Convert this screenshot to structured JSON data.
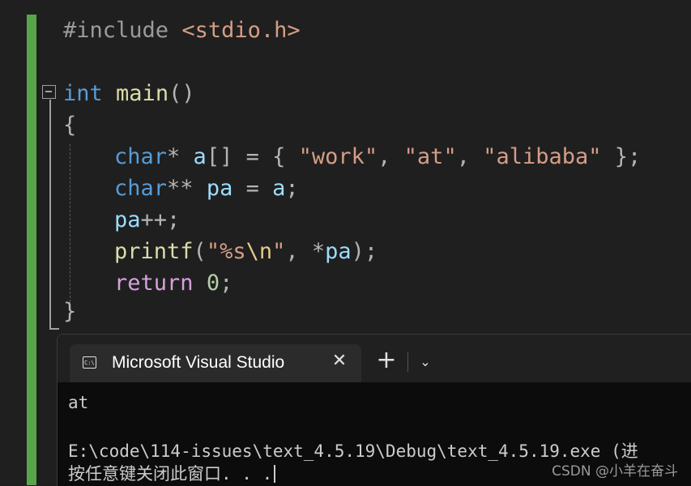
{
  "editor": {
    "lines": [
      [
        "#include ",
        "<stdio.h>"
      ],
      [],
      [
        "int",
        " ",
        "main",
        "()"
      ],
      [
        "{"
      ],
      [
        "char",
        "* ",
        "a",
        "[] = { ",
        "\"work\"",
        ", ",
        "\"at\"",
        ", ",
        "\"alibaba\"",
        " };"
      ],
      [
        "char",
        "** ",
        "pa",
        " = ",
        "a",
        ";"
      ],
      [
        "pa",
        "++;"
      ],
      [
        "printf",
        "(",
        "\"%s",
        "\\n",
        "\"",
        ", *",
        "pa",
        ");"
      ],
      [
        "return",
        " ",
        "0",
        ";"
      ],
      [
        "}"
      ]
    ]
  },
  "terminal": {
    "tab_title": "Microsoft Visual Studio",
    "close_glyph": "✕",
    "new_tab_glyph": "+",
    "dropdown_glyph": "⌄",
    "output_lines": [
      "at",
      "",
      "E:\\code\\114-issues\\text_4.5.19\\Debug\\text_4.5.19.exe (进",
      "按任意键关闭此窗口. . ."
    ]
  },
  "watermark": "CSDN @小羊在奋斗",
  "colors": {
    "change_bar": "#57a64a",
    "keyword": "#569cd6",
    "function": "#dcdcaa",
    "variable": "#9cdcfe",
    "string": "#d69d85",
    "number": "#b5cea8",
    "control": "#d8a0df"
  },
  "icons": {
    "tab_icon": "terminal-icon",
    "fold": "collapse-icon"
  }
}
